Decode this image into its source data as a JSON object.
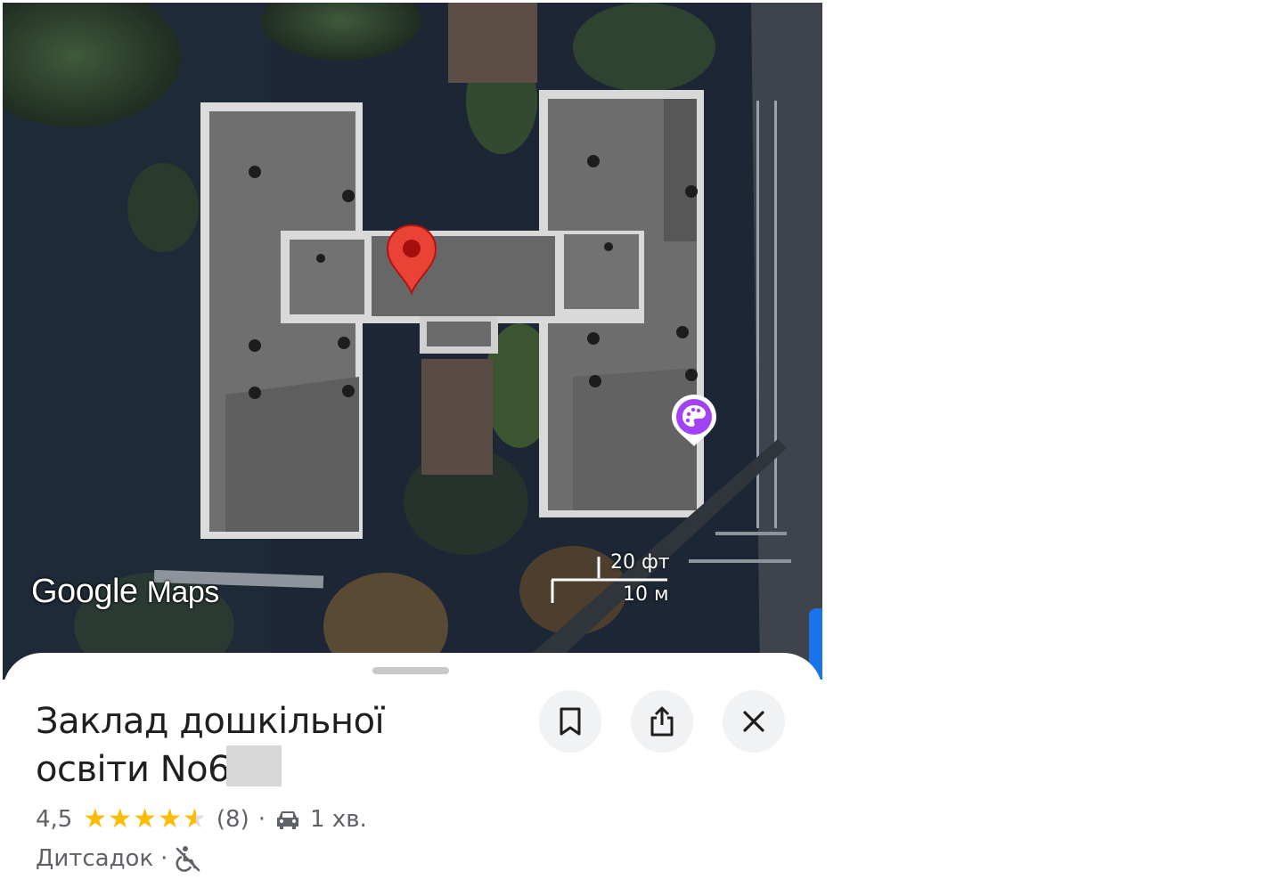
{
  "map": {
    "logo_google": "Google",
    "logo_maps": "Maps",
    "scale_ft": "20 фт",
    "scale_m": "10 м",
    "pin_icon": "red-location-pin-icon",
    "poi_icon": "palette-poi-icon"
  },
  "place": {
    "title_line1": "Заклад дошкільної",
    "title_line2": "освіти No6",
    "rating": "4,5",
    "rating_fraction": 0.9,
    "review_count": "(8)",
    "separator": "·",
    "drive_time": "1 хв.",
    "category": "Дитсадок",
    "category_separator": "·"
  },
  "actions": {
    "save_icon": "bookmark-icon",
    "share_icon": "share-icon",
    "close_icon": "close-icon"
  },
  "colors": {
    "accent_star": "#fbbc04",
    "pin_red": "#ea4335",
    "poi_purple": "#a142f4"
  }
}
